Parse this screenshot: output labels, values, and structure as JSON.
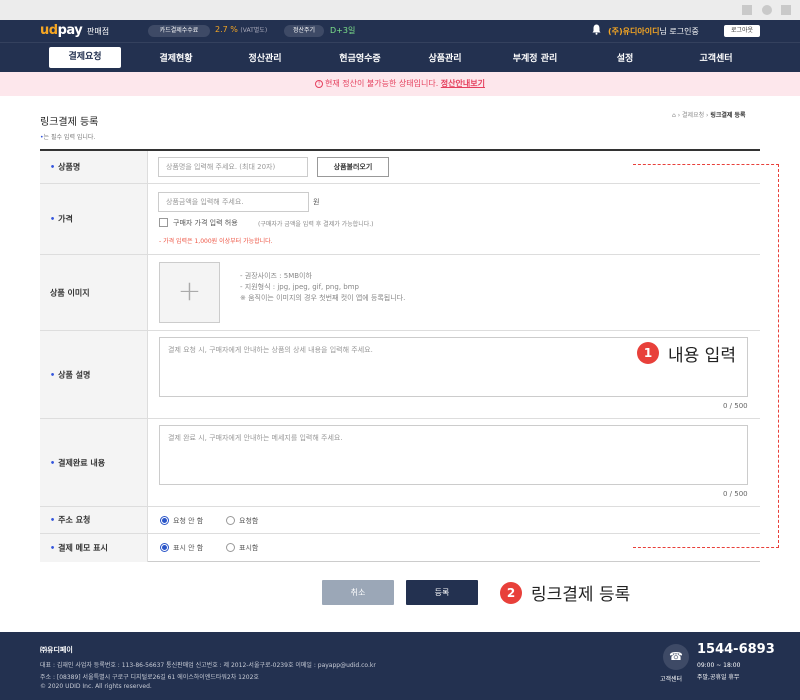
{
  "header": {
    "logo_ud": "ud",
    "logo_pay": "pay",
    "seller_label": "판매점",
    "fee_pill": "카드결제수수료",
    "fee_rate": "2.7 %",
    "fee_vat": "(VAT별도)",
    "cycle_pill": "정산주기",
    "cycle_value": "D+3일",
    "company_name": "(주)유디아이디",
    "company_suffix": "님 로그인중",
    "logout": "로그아웃"
  },
  "nav": {
    "items": [
      "결제요청",
      "결제현황",
      "정산관리",
      "현금영수증",
      "상품관리",
      "부계정 관리",
      "설정",
      "고객센터"
    ]
  },
  "notice": {
    "text": "현재 정산이 불가능한 상태입니다.",
    "link": "정산안내보기"
  },
  "page": {
    "title": "링크결제 등록",
    "required_mark": "•",
    "required_note": "는 필수 입력 입니다.",
    "breadcrumb_home": "⌂",
    "breadcrumb_mid": "› 결제요청 ›",
    "breadcrumb_current": "링크결제 등록"
  },
  "form": {
    "product_name": {
      "label": "상품명",
      "placeholder": "상품명을 입력해 주세요. (최대 20자)",
      "button": "상품불러오기"
    },
    "price": {
      "label": "가격",
      "placeholder": "상품금액을 입력해 주세요.",
      "unit": "원",
      "checkbox_label": "구매자 가격 입력 허용",
      "checkbox_hint": "(구매자가 금액을 입력 후 결제가 가능합니다.)",
      "min_note": "- 가격 입력은 1,000원 이상부터 가능합니다."
    },
    "image": {
      "label": "상품 이미지",
      "plus": "+",
      "notes": [
        "- 권장사이즈 : 5MB이하",
        "- 지원형식 : jpg, jpeg, gif, png, bmp",
        "※ 움직이는 이미지의 경우 첫번째 컷이 앱에 등록됩니다."
      ]
    },
    "description": {
      "label": "상품 설명",
      "placeholder": "결제 요청 시, 구매자에게 안내하는 상품의 상세 내용을 입력해 주세요.",
      "counter": "0 / 500"
    },
    "completion": {
      "label": "결제완료 내용",
      "placeholder": "결제 완료 시, 구매자에게 안내하는 메세지를 입력해 주세요.",
      "counter": "0 / 500"
    },
    "address": {
      "label": "주소 요청",
      "opt1": "요청 안 함",
      "opt2": "요청함",
      "selected": "요청 안 함"
    },
    "memo": {
      "label": "결제 메모 표시",
      "opt1": "표시 안 함",
      "opt2": "표시함",
      "selected": "표시 안 함"
    }
  },
  "annotations": {
    "step1_num": "1",
    "step1_text": "내용 입력",
    "step2_num": "2",
    "step2_text": "링크결제 등록",
    "color": "#e8403a"
  },
  "buttons": {
    "cancel": "취소",
    "submit": "등록"
  },
  "footer": {
    "company": "㈜유디페이",
    "line1": "대표 : 김재인 사업자 등록번호 : 113-86-56637 통신판매업 신고번호 : 제 2012-서울구로-0239호 이메일 : payapp@udid.co.kr",
    "line2": "주소 : [08389] 서울특별시 구로구 디지털로26길 61 에이스하이엔드타워2차 1202호",
    "line3": "© 2020 UDID Inc. All rights reserved.",
    "cs_label": "고객센터",
    "tel": "1544-6893",
    "hours": "09:00 ~ 18:00",
    "holiday": "주말,공휴일 휴무"
  },
  "colors": {
    "navy": "#233150",
    "accent_orange": "#f5a623",
    "required_blue": "#3355dd",
    "notice_bg": "#fde7ec"
  }
}
